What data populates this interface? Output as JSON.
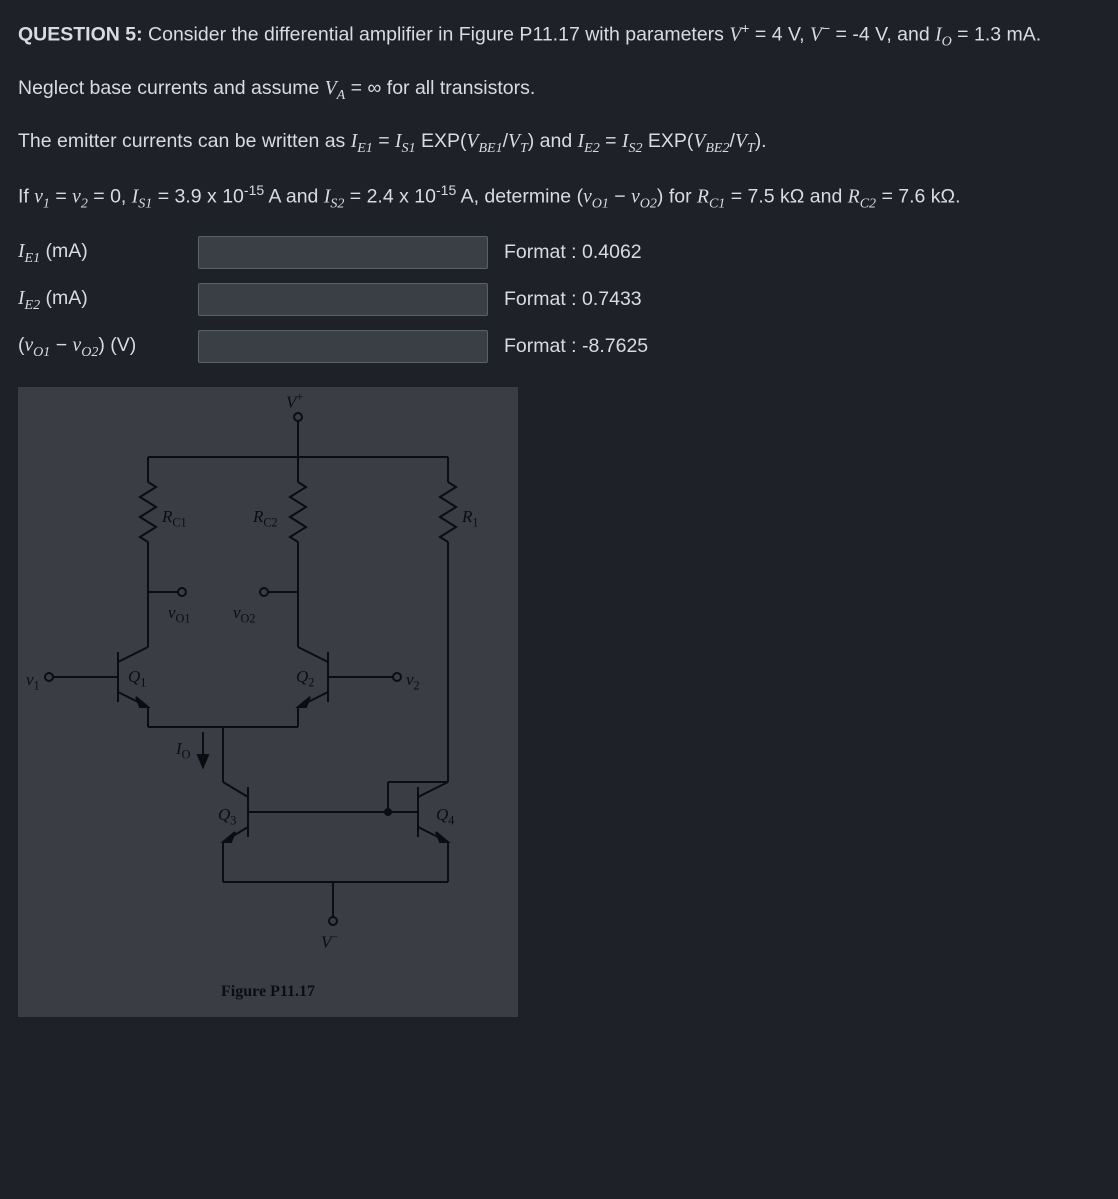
{
  "q": {
    "heading": "QUESTION 5:",
    "p1a": " Consider the differential amplifier in Figure P11.17 with parameters ",
    "p1b": " = 4 V, ",
    "p1c": " = -4 V, and ",
    "p1d": " = 1.3 mA.",
    "p2a": "Neglect base currents and assume ",
    "p2b": " = ∞ for all transistors.",
    "p3a": "The emitter currents can be written as ",
    "p3b": " = ",
    "p3c": " EXP(",
    "p3d": "/",
    "p3e": ") and ",
    "p3f": " = ",
    "p3g": " EXP(",
    "p3h": "/",
    "p3i": ").",
    "p4a": "If ",
    "p4b": " = ",
    "p4c": " = 0, ",
    "p4d": " = 3.9 x 10",
    "p4e": " A and ",
    "p4f": " = 2.4 x 10",
    "p4g": " A, determine (",
    "p4h": " − ",
    "p4i": ") for ",
    "p4j": " = 7.5 kΩ and ",
    "p4k": " = 7.6 kΩ.",
    "exp": "-15",
    "sym": {
      "Vp": "V",
      "Vp_sup": "+",
      "Vm": "V",
      "Vm_sup": "−",
      "Io": "I",
      "Io_sub": "O",
      "VA": "V",
      "VA_sub": "A",
      "IE1": "I",
      "IE1_sub": "E1",
      "IE2": "I",
      "IE2_sub": "E2",
      "IS1": "I",
      "IS1_sub": "S1",
      "IS2": "I",
      "IS2_sub": "S2",
      "VBE1": "V",
      "VBE1_sub": "BE1",
      "VBE2": "V",
      "VBE2_sub": "BE2",
      "VT": "V",
      "VT_sub": "T",
      "v1": "v",
      "v1_sub": "1",
      "v2": "v",
      "v2_sub": "2",
      "vO1": "v",
      "vO1_sub": "O1",
      "vO2": "v",
      "vO2_sub": "O2",
      "RC1": "R",
      "RC1_sub": "C1",
      "RC2": "R",
      "RC2_sub": "C2"
    }
  },
  "answers": {
    "rows": [
      {
        "label_i": "I",
        "label_sub": "E1",
        "unit": " (mA)",
        "format": "Format : 0.4062"
      },
      {
        "label_i": "I",
        "label_sub": "E2",
        "unit": " (mA)",
        "format": "Format : 0.7433"
      },
      {
        "label_prefix": "(",
        "label_i": "v",
        "label_sub": "O1",
        "mid": " − ",
        "label_i2": "v",
        "label_sub2": "O2",
        "label_suffix": ") (V)",
        "format": "Format : -8.7625"
      }
    ]
  },
  "figure": {
    "caption": "Figure P11.17",
    "labels": {
      "Vp": "V",
      "Vp_sup": "+",
      "Vm": "V",
      "Vm_sup": "−",
      "RC1": "R",
      "RC1_sub": "C1",
      "RC2": "R",
      "RC2_sub": "C2",
      "R1": "R",
      "R1_sub": "1",
      "vO1": "v",
      "vO1_sub": "O1",
      "vO2": "v",
      "vO2_sub": "O2",
      "v1": "v",
      "v1_sub": "1",
      "v2": "v",
      "v2_sub": "2",
      "Q1": "Q",
      "Q1_sub": "1",
      "Q2": "Q",
      "Q2_sub": "2",
      "Q3": "Q",
      "Q3_sub": "3",
      "Q4": "Q",
      "Q4_sub": "4",
      "Io": "I",
      "Io_sub": "O"
    }
  }
}
